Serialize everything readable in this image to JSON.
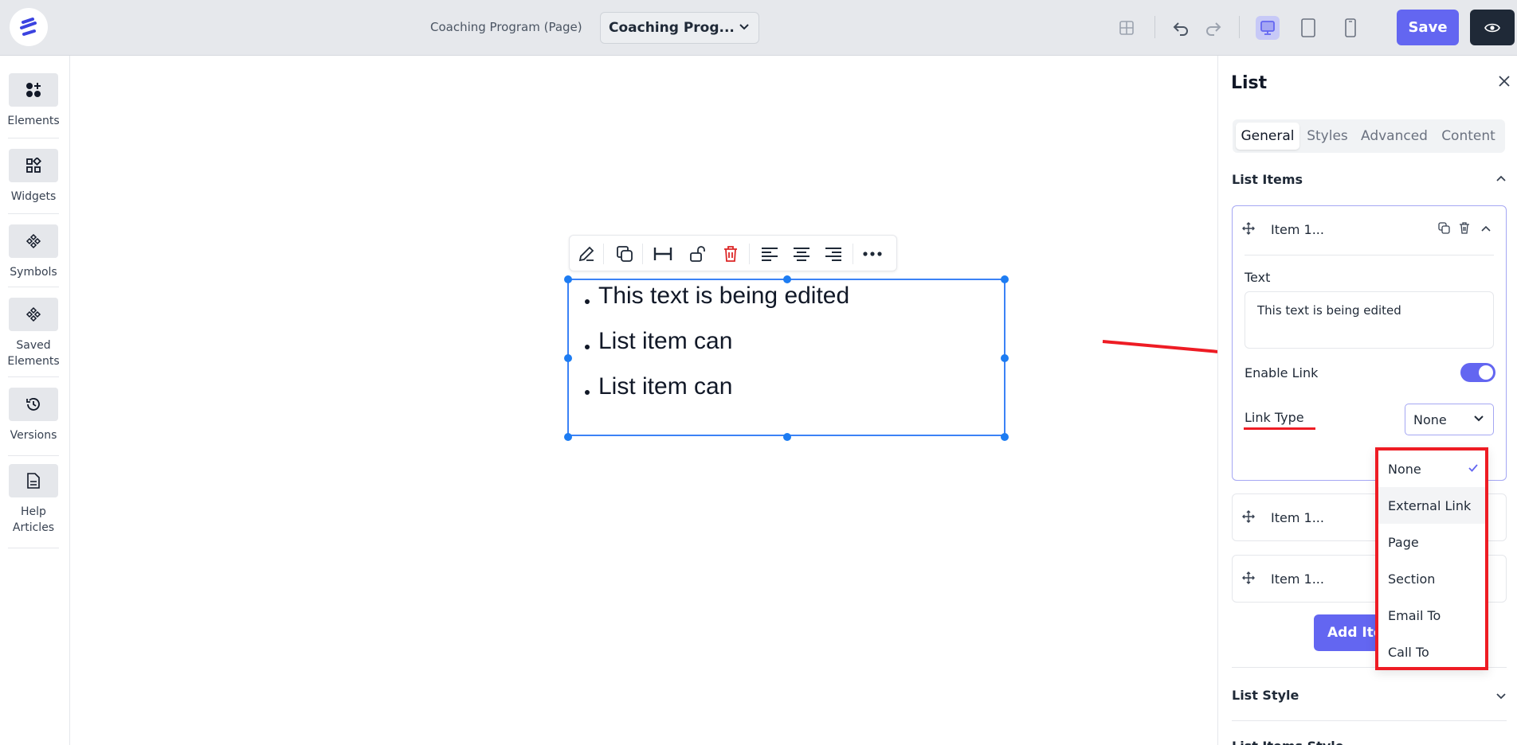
{
  "topbar": {
    "page_label": "Coaching Program (Page)",
    "page_select_value": "Coaching Prog...",
    "save_label": "Save"
  },
  "sidebar": {
    "items": [
      {
        "label": "Elements",
        "icon": "elements-icon"
      },
      {
        "label": "Widgets",
        "icon": "widgets-icon"
      },
      {
        "label": "Symbols",
        "icon": "symbols-icon"
      },
      {
        "label": "Saved Elements",
        "icon": "saved-elements-icon"
      },
      {
        "label": "Versions",
        "icon": "history-icon"
      },
      {
        "label": "Help Articles",
        "icon": "document-icon"
      }
    ]
  },
  "canvas": {
    "list_items": [
      "This text is being edited",
      "List item can",
      "List item can"
    ]
  },
  "panel": {
    "title": "List",
    "tabs": [
      "General",
      "Styles",
      "Advanced",
      "Content"
    ],
    "active_tab": "General",
    "section_list_items": "List Items",
    "items": [
      {
        "name": "Item 1..."
      },
      {
        "name": "Item 1..."
      },
      {
        "name": "Item 1..."
      }
    ],
    "text_label": "Text",
    "text_value": "This text is being edited",
    "enable_link_label": "Enable Link",
    "enable_link_on": true,
    "link_type_label": "Link Type",
    "link_type_value": "None",
    "add_item_label": "Add Ite",
    "section_list_style": "List Style",
    "section_list_items_style": "List Items Style"
  },
  "dropdown": {
    "options": [
      "None",
      "External Link",
      "Page",
      "Section",
      "Email To",
      "Call To"
    ],
    "selected": "None",
    "hovered": "External Link"
  },
  "colors": {
    "accent": "#6366f1",
    "annotation": "#ee1c24",
    "selection": "#3b82f6"
  }
}
